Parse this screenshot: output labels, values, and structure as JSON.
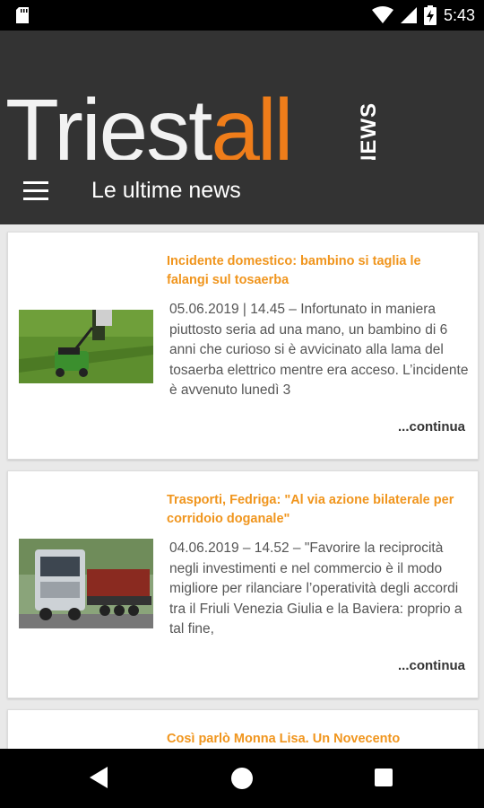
{
  "status": {
    "time": "5:43"
  },
  "brand": {
    "part1": "Triest",
    "part2": "all",
    "tag": "NEWS"
  },
  "appbar": {
    "title": "Le ultime news"
  },
  "articles": [
    {
      "title": "Incidente domestico: bambino si taglia le falangi sul tosaerba",
      "excerpt": "05.06.2019 | 14.45 – Infortunato in maniera piuttosto seria ad una mano, un bambino di 6 anni che curioso si è avvicinato alla lama del tosaerba elettrico mentre era acceso. L’incidente è avvenuto lunedì 3",
      "more": "...continua",
      "image": "lawn-mower-photo"
    },
    {
      "title": "Trasporti, Fedriga: \"Al via azione bilaterale per corridoio doganale\"",
      "excerpt": "04.06.2019 – 14.52 – \"Favorire la reciprocità negli investimenti e nel commercio è il modo migliore per rilanciare l’operatività degli accordi tra il Friuli Venezia Giulia e la Baviera: proprio a tal fine,",
      "more": "...continua",
      "image": "truck-photo"
    },
    {
      "title": "Così parlò Monna Lisa. Un Novecento",
      "excerpt": "",
      "more": "",
      "image": ""
    }
  ],
  "colors": {
    "accent": "#ef7d1a",
    "bar": "#333333",
    "title": "#f0951d"
  },
  "icons": {
    "menu": "hamburger-menu-icon",
    "back": "back-icon",
    "home": "home-icon",
    "recent": "recent-apps-icon"
  }
}
